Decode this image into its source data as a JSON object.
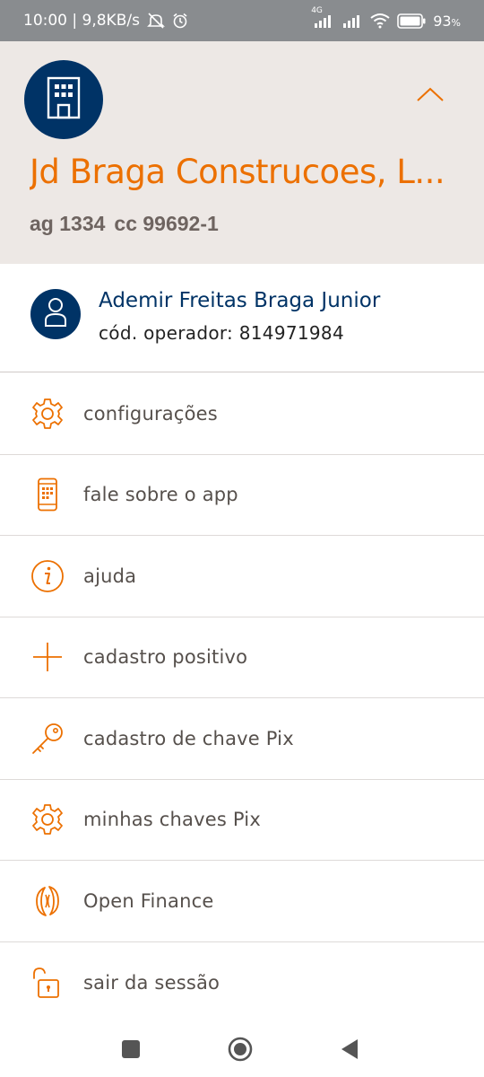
{
  "status_bar": {
    "time_speed": "10:00 | 9,8KB/s",
    "network_label": "4G",
    "battery": "93",
    "icons": [
      "mute-icon",
      "alarm-icon",
      "signal-icon",
      "signal-icon",
      "wifi-icon",
      "battery-icon"
    ]
  },
  "header": {
    "company_name": "Jd Braga Construcoes, L...",
    "agency": "ag 1334",
    "account": "cc 99692-1",
    "icons": [
      "building-icon",
      "chevron-up-icon"
    ]
  },
  "user": {
    "name": "Ademir Freitas Braga Junior",
    "operator_code": "cód. operador: 814971984",
    "icon": "person-icon"
  },
  "menu": {
    "items": [
      {
        "label": "configurações",
        "icon": "gear-icon"
      },
      {
        "label": "fale sobre o app",
        "icon": "phone-app-icon"
      },
      {
        "label": "ajuda",
        "icon": "info-icon"
      },
      {
        "label": "cadastro positivo",
        "icon": "plus-icon"
      },
      {
        "label": "cadastro de chave Pix",
        "icon": "key-icon"
      },
      {
        "label": "minhas chaves Pix",
        "icon": "gear-icon"
      },
      {
        "label": "Open Finance",
        "icon": "open-finance-icon"
      },
      {
        "label": "sair da sessão",
        "icon": "unlock-icon"
      }
    ]
  },
  "colors": {
    "brand_orange": "#ec7000",
    "brand_navy": "#003366",
    "header_bg": "#ede8e5",
    "status_bar_bg": "#898c8f"
  },
  "nav_bar": {
    "icons": [
      "recent-apps-icon",
      "home-icon",
      "back-icon"
    ]
  }
}
